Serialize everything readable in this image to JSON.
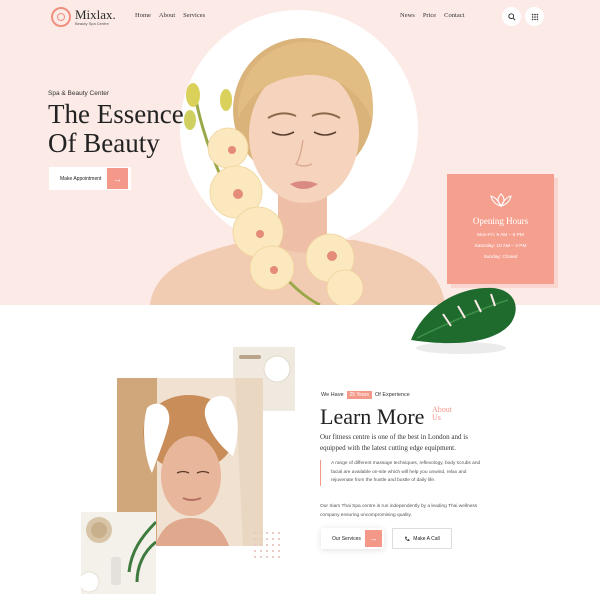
{
  "brand": {
    "name": "Mixlax.",
    "tagline": "Beauty Spa Centre",
    "accent": "#f4988a",
    "hero_bg": "#fbeae6"
  },
  "nav": {
    "left": [
      "Home",
      "About",
      "Services"
    ],
    "right": [
      "News",
      "Price",
      "Contact"
    ]
  },
  "header_icons": [
    "search-icon",
    "grid-menu-icon"
  ],
  "hero": {
    "subtitle": "Spa & Beauty Center",
    "title_line1": "The Essence",
    "title_line2": "Of Beauty",
    "cta": "Make Appointment"
  },
  "hours": {
    "title": "Opening Hours",
    "weekdays": "Mon-Fri: 9 AM – 6 PM",
    "saturday": "Saturday: 10 AM – 3 PM",
    "sunday": "Sunday: Closed"
  },
  "about": {
    "exp_prefix": "We Have",
    "exp_years": "25 Years",
    "exp_suffix": "Of Experience",
    "title": "Learn More",
    "title_accent": "About Us",
    "lead": "Our fitness centre is one of the best in London and is equipped with the latest cutting edge equipment.",
    "quote": "A range of different massage techniques, reflexology, body scrubs and facial are available on-site which will help you unwind, relax and rejuvenate from the hustle and bustle of daily life.",
    "para": "Our Siam Thai Spa centre is run independently by a leading Thai wellness company ensuring uncompromising quality.",
    "btn_services": "Our Services",
    "btn_call": "Make A Call"
  }
}
